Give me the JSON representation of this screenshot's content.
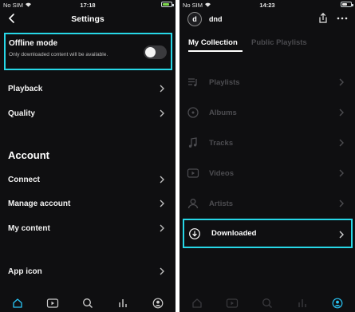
{
  "left": {
    "status": {
      "carrier": "No SIM",
      "time": "17:18"
    },
    "header": {
      "title": "Settings"
    },
    "offline": {
      "title": "Offline mode",
      "description": "Only downloaded content will be available."
    },
    "rows": {
      "playback": "Playback",
      "quality": "Quality"
    },
    "account": {
      "heading": "Account",
      "connect": "Connect",
      "manage": "Manage account",
      "content": "My content"
    },
    "appicon": "App icon"
  },
  "right": {
    "status": {
      "carrier": "No SIM",
      "time": "14:23"
    },
    "profile": {
      "initial": "d",
      "name": "dnd"
    },
    "tabs": {
      "collection": "My Collection",
      "public": "Public Playlists"
    },
    "items": {
      "playlists": "Playlists",
      "albums": "Albums",
      "tracks": "Tracks",
      "videos": "Videos",
      "artists": "Artists",
      "downloaded": "Downloaded"
    }
  },
  "colors": {
    "highlight": "#27d7e7",
    "background": "#0f0f11",
    "active_tab_icon": "#29c5f6",
    "battery": "#7cd84b"
  },
  "icons": {
    "nav": [
      "home-icon",
      "videos-icon",
      "search-icon",
      "my-collection-icon",
      "profile-icon"
    ]
  }
}
